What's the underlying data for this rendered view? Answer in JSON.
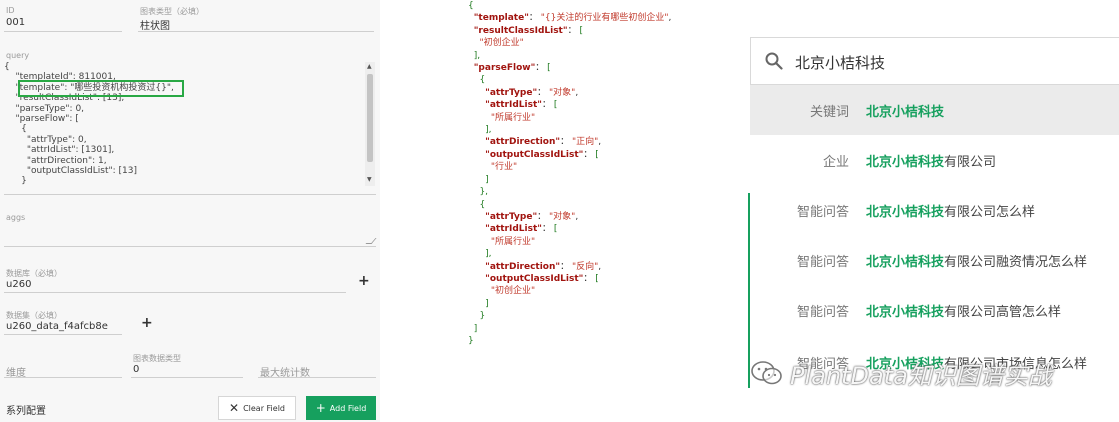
{
  "form": {
    "id_label": "ID",
    "id_value": "001",
    "chart_type_label": "图表类型（必填）",
    "chart_type_value": "柱状图",
    "query_label": "query",
    "query_lines": [
      "{",
      "    \"templateId\": 811001,",
      "    \"template\": \"哪些投资机构投资过{}\",",
      "    \"resultClassIdList\": [13],",
      "    \"parseType\": 0,",
      "    \"parseFlow\": [",
      "      {",
      "        \"attrType\": 0,",
      "        \"attrIdList\": [1301],",
      "        \"attrDirection\": 1,",
      "        \"outputClassIdList\": [13]",
      "      }"
    ],
    "aggs_label": "aggs",
    "database_label": "数据库（必填）",
    "database_value": "u260",
    "dataset_label": "数据集（必填）",
    "dataset_value": "u260_data_f4afcb8e",
    "dimension_label": "维度",
    "chart_data_type_label": "图表数据类型",
    "chart_data_type_value": "0",
    "max_stat_label": "最大统计数",
    "series_config_label": "系列配置",
    "clear_field_label": "Clear Field",
    "add_field_label": "Add Field"
  },
  "json_view": {
    "lines": [
      [
        {
          "t": "p",
          "v": "{"
        }
      ],
      [
        {
          "t": "s",
          "v": "  "
        },
        {
          "t": "k",
          "v": "\"template\""
        },
        {
          "t": "s",
          "v": "： "
        },
        {
          "t": "v",
          "v": "\"{}关注的行业有哪些初创企业\""
        },
        {
          "t": "s",
          "v": ","
        }
      ],
      [
        {
          "t": "s",
          "v": "  "
        },
        {
          "t": "k",
          "v": "\"resultClassIdList\""
        },
        {
          "t": "s",
          "v": "： "
        },
        {
          "t": "p",
          "v": "["
        }
      ],
      [
        {
          "t": "s",
          "v": "    "
        },
        {
          "t": "v",
          "v": "\"初创企业\""
        }
      ],
      [
        {
          "t": "s",
          "v": "  "
        },
        {
          "t": "p",
          "v": "],"
        }
      ],
      [
        {
          "t": "s",
          "v": "  "
        },
        {
          "t": "k",
          "v": "\"parseFlow\""
        },
        {
          "t": "s",
          "v": "： "
        },
        {
          "t": "p",
          "v": "["
        }
      ],
      [
        {
          "t": "s",
          "v": "    "
        },
        {
          "t": "p",
          "v": "{"
        }
      ],
      [
        {
          "t": "s",
          "v": "      "
        },
        {
          "t": "k",
          "v": "\"attrType\""
        },
        {
          "t": "s",
          "v": "： "
        },
        {
          "t": "v",
          "v": "\"对象\""
        },
        {
          "t": "s",
          "v": ","
        }
      ],
      [
        {
          "t": "s",
          "v": "      "
        },
        {
          "t": "k",
          "v": "\"attrIdList\""
        },
        {
          "t": "s",
          "v": "： "
        },
        {
          "t": "p",
          "v": "["
        }
      ],
      [
        {
          "t": "s",
          "v": "        "
        },
        {
          "t": "v",
          "v": "\"所属行业\""
        }
      ],
      [
        {
          "t": "s",
          "v": "      "
        },
        {
          "t": "p",
          "v": "],"
        }
      ],
      [
        {
          "t": "s",
          "v": "      "
        },
        {
          "t": "k",
          "v": "\"attrDirection\""
        },
        {
          "t": "s",
          "v": "： "
        },
        {
          "t": "v",
          "v": "\"正向\""
        },
        {
          "t": "s",
          "v": ","
        }
      ],
      [
        {
          "t": "s",
          "v": "      "
        },
        {
          "t": "k",
          "v": "\"outputClassIdList\""
        },
        {
          "t": "s",
          "v": "： "
        },
        {
          "t": "p",
          "v": "["
        }
      ],
      [
        {
          "t": "s",
          "v": "        "
        },
        {
          "t": "v",
          "v": "\"行业\""
        }
      ],
      [
        {
          "t": "s",
          "v": "      "
        },
        {
          "t": "p",
          "v": "]"
        }
      ],
      [
        {
          "t": "s",
          "v": "    "
        },
        {
          "t": "p",
          "v": "},"
        }
      ],
      [
        {
          "t": "s",
          "v": "    "
        },
        {
          "t": "p",
          "v": "{"
        }
      ],
      [
        {
          "t": "s",
          "v": "      "
        },
        {
          "t": "k",
          "v": "\"attrType\""
        },
        {
          "t": "s",
          "v": "： "
        },
        {
          "t": "v",
          "v": "\"对象\""
        },
        {
          "t": "s",
          "v": ","
        }
      ],
      [
        {
          "t": "s",
          "v": "      "
        },
        {
          "t": "k",
          "v": "\"attrIdList\""
        },
        {
          "t": "s",
          "v": "： "
        },
        {
          "t": "p",
          "v": "["
        }
      ],
      [
        {
          "t": "s",
          "v": "        "
        },
        {
          "t": "v",
          "v": "\"所属行业\""
        }
      ],
      [
        {
          "t": "s",
          "v": "      "
        },
        {
          "t": "p",
          "v": "],"
        }
      ],
      [
        {
          "t": "s",
          "v": "      "
        },
        {
          "t": "k",
          "v": "\"attrDirection\""
        },
        {
          "t": "s",
          "v": "： "
        },
        {
          "t": "v",
          "v": "\"反向\""
        },
        {
          "t": "s",
          "v": ","
        }
      ],
      [
        {
          "t": "s",
          "v": "      "
        },
        {
          "t": "k",
          "v": "\"outputClassIdList\""
        },
        {
          "t": "s",
          "v": "： "
        },
        {
          "t": "p",
          "v": "["
        }
      ],
      [
        {
          "t": "s",
          "v": "        "
        },
        {
          "t": "v",
          "v": "\"初创企业\""
        }
      ],
      [
        {
          "t": "s",
          "v": "      "
        },
        {
          "t": "p",
          "v": "]"
        }
      ],
      [
        {
          "t": "s",
          "v": "    "
        },
        {
          "t": "p",
          "v": "}"
        }
      ],
      [
        {
          "t": "s",
          "v": "  "
        },
        {
          "t": "p",
          "v": "]"
        }
      ],
      [
        {
          "t": "p",
          "v": "}"
        }
      ]
    ]
  },
  "search": {
    "query": "北京小桔科技",
    "icon": "search-icon",
    "suggestions": [
      {
        "category": "关键词",
        "match": "北京小桔科技",
        "rest": ""
      },
      {
        "category": "企业",
        "match": "北京小桔科技",
        "rest": "有限公司"
      },
      {
        "category": "智能问答",
        "match": "北京小桔科技",
        "rest": "有限公司怎么样"
      },
      {
        "category": "智能问答",
        "match": "北京小桔科技",
        "rest": "有限公司融资情况怎么样"
      },
      {
        "category": "智能问答",
        "match": "北京小桔科技",
        "rest": "有限公司高管怎么样"
      },
      {
        "category": "智能问答",
        "match": "北京小桔科技",
        "rest": "有限公司市场信息怎么样"
      }
    ]
  },
  "watermark": {
    "text": "PlantData知识图谱实战",
    "icon": "wechat-icon"
  },
  "colors": {
    "accent_green": "#16a05e",
    "highlight_box": "#29a844",
    "json_key": "#a1140f",
    "json_punct": "#1f7a1f",
    "json_value": "#c0392b"
  }
}
